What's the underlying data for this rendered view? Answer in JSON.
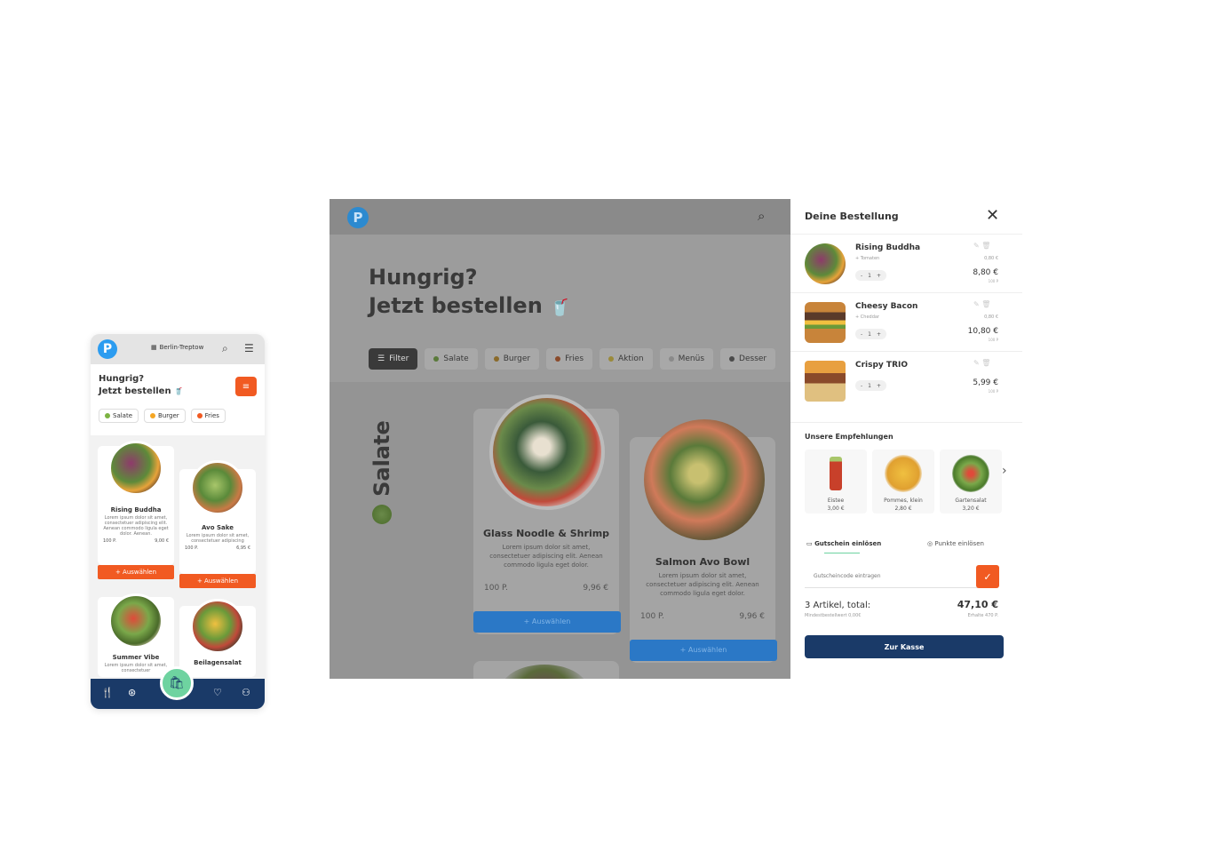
{
  "colors": {
    "accent": "#f15a22",
    "brand_blue": "#2c9cf0",
    "navy": "#1a3a68",
    "mint": "#6ed3a0"
  },
  "mobile": {
    "location": "Berlin-Treptow",
    "title_line1": "Hungrig?",
    "title_line2": "Jetzt bestellen",
    "chips": [
      {
        "label": "Salate",
        "color": "#7cb342"
      },
      {
        "label": "Burger",
        "color": "#f5a623"
      },
      {
        "label": "Fries",
        "color": "#f15a22"
      }
    ],
    "products": [
      {
        "name": "Rising Buddha",
        "desc": "Lorem ipsum dolor sit amet, consectetuer adipiscing elit. Aenean commodo ligula eget dolor. Aenean.",
        "points": "100 P.",
        "price": "9,00 €",
        "select": "+ Auswählen"
      },
      {
        "name": "Avo Sake",
        "desc": "Lorem ipsum dolor sit amet, consectetuer adipiscing",
        "points": "100 P.",
        "price": "6,95 €",
        "select": "+ Auswählen"
      },
      {
        "name": "Summer Vibe",
        "desc": "Lorem ipsum dolor sit amet, consectetuer"
      },
      {
        "name": "Beilagensalat"
      }
    ],
    "nav_icons": [
      "cutlery-icon",
      "offers-icon",
      "cart-icon",
      "heart-icon",
      "profile-icon"
    ]
  },
  "desktop": {
    "title_line1": "Hungrig?",
    "title_line2": "Jetzt bestellen",
    "filter_label": "Filter",
    "chips": [
      {
        "label": "Salate"
      },
      {
        "label": "Burger"
      },
      {
        "label": "Fries"
      },
      {
        "label": "Aktion"
      },
      {
        "label": "Menüs"
      },
      {
        "label": "Desser"
      }
    ],
    "section_title": "Salate",
    "products": [
      {
        "name": "Glass Noodle & Shrimp",
        "desc": "Lorem ipsum dolor sit amet, consectetuer adipiscing elit. Aenean commodo ligula eget dolor.",
        "points": "100 P.",
        "price": "9,96 €",
        "select": "+ Auswählen"
      },
      {
        "name": "Salmon Avo Bowl",
        "desc": "Lorem ipsum dolor sit amet, consectetuer adipiscing elit. Aenean commodo ligula eget dolor.",
        "points": "100 P.",
        "price": "9,96 €",
        "select": "+ Auswählen"
      }
    ]
  },
  "order": {
    "title": "Deine Bestellung",
    "items": [
      {
        "name": "Rising Buddha",
        "extra": "+ Tomaten",
        "qty": "1",
        "extra_price": "0,80 €",
        "price": "8,80 €",
        "points": "100 P"
      },
      {
        "name": "Cheesy Bacon",
        "extra": "+ Cheddar",
        "qty": "1",
        "extra_price": "0,80 €",
        "price": "10,80 €",
        "points": "100 P"
      },
      {
        "name": "Crispy TRIO",
        "extra": "",
        "qty": "1",
        "extra_price": "",
        "price": "5,99 €",
        "points": "100 P"
      }
    ],
    "recs_title": "Unsere Empfehlungen",
    "recs": [
      {
        "name": "Eistee",
        "price": "3,00 €"
      },
      {
        "name": "Pommes, klein",
        "price": "2,80 €"
      },
      {
        "name": "Gartensalat",
        "price": "3,20 €"
      }
    ],
    "tab_voucher": "Gutschein einlösen",
    "tab_points": "Punkte einlösen",
    "voucher_placeholder": "Gutscheincode eintragen",
    "total_label": "3 Artikel, total:",
    "total_value": "47,10 €",
    "min_order": "Mindestbestellwert 0,00€",
    "earn_points": "Erhalte 470 P.",
    "checkout": "Zur Kasse"
  }
}
